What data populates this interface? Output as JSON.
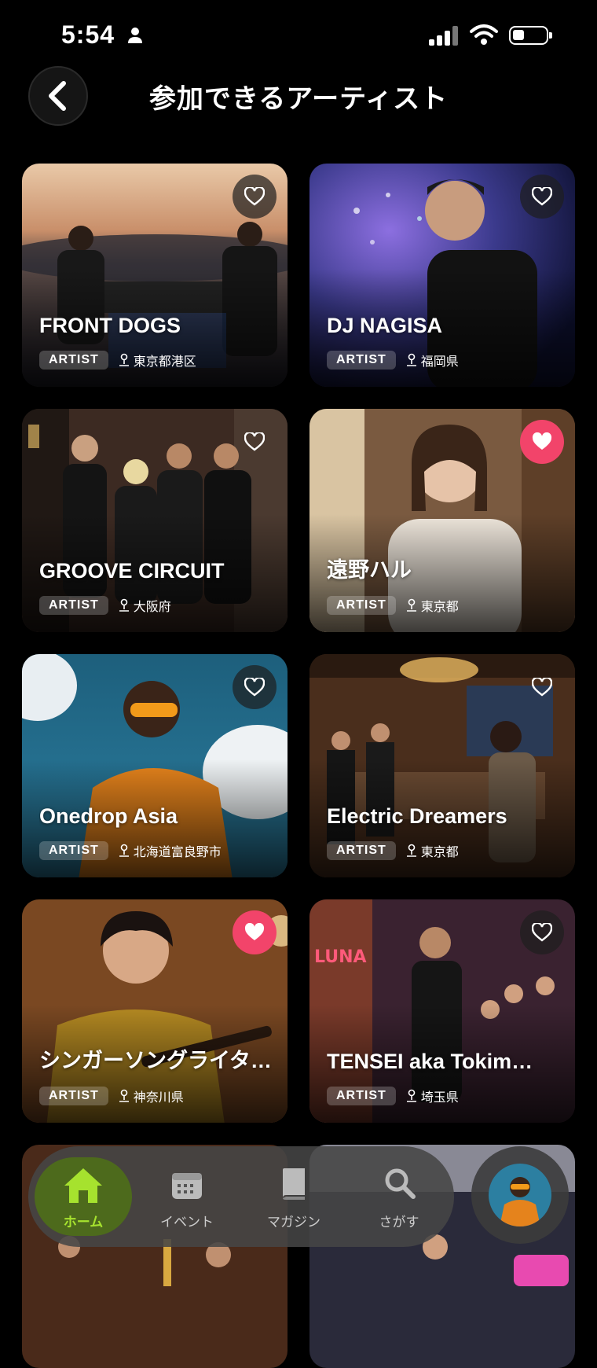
{
  "status_bar": {
    "time": "5:54"
  },
  "header": {
    "title": "参加できるアーティスト"
  },
  "cards": [
    {
      "name": "FRONT DOGS",
      "badge": "ARTIST",
      "location": "東京都港区",
      "liked": false
    },
    {
      "name": "DJ NAGISA",
      "badge": "ARTIST",
      "location": "福岡県",
      "liked": false
    },
    {
      "name": "GROOVE CIRCUIT",
      "badge": "ARTIST",
      "location": "大阪府",
      "liked": false
    },
    {
      "name": "遠野ハル",
      "badge": "ARTIST",
      "location": "東京都",
      "liked": true
    },
    {
      "name": "Onedrop Asia",
      "badge": "ARTIST",
      "location": "北海道富良野市",
      "liked": false
    },
    {
      "name": "Electric Dreamers",
      "badge": "ARTIST",
      "location": "東京都",
      "liked": false
    },
    {
      "name": "シンガーソングライタ…",
      "badge": "ARTIST",
      "location": "神奈川県",
      "liked": true
    },
    {
      "name": "TENSEI aka Tokim…",
      "badge": "ARTIST",
      "location": "埼玉県",
      "liked": false
    }
  ],
  "bottom_nav": {
    "items": [
      {
        "label": "ホーム",
        "icon": "home-icon",
        "active": true
      },
      {
        "label": "イベント",
        "icon": "calendar-icon",
        "active": false
      },
      {
        "label": "マガジン",
        "icon": "book-icon",
        "active": false
      },
      {
        "label": "さがす",
        "icon": "search-icon",
        "active": false
      }
    ]
  },
  "colors": {
    "accent": "#a6e22e",
    "like": "#f2446a",
    "background": "#000000"
  }
}
